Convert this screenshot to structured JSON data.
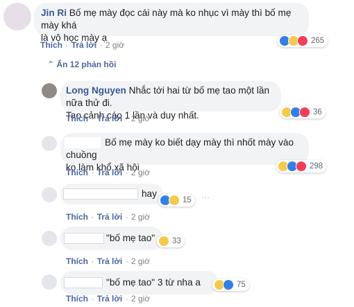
{
  "comments": [
    {
      "name": "Jin Ri",
      "text_line1": "Bố mẹ mày đọc cái này mà ko nhục vì mày thì bố mẹ mày khá",
      "text_line2": "là vô học mày ạ",
      "like": "Thích",
      "reply": "Trả lời",
      "time": "2 giờ",
      "reaction_count": "265"
    }
  ],
  "hidden_replies": "Ẩn 12 phản hồi",
  "replies": [
    {
      "name": "Long Nguyen",
      "text_line1": "Nhắc tới hai từ bố mẹ tao một lần nữa thử đi.",
      "text_line2": "Tao cảnh cáo 1 lần và duy nhất.",
      "like": "Thích",
      "reply": "Trả lời",
      "time": "2 giờ",
      "reaction_count": "36"
    },
    {
      "text_line1": "Bố mẹ mày ko biết dạy mày thì nhốt mày vào chuồng",
      "text_line2": "ko làm khổ xã hội",
      "like": "Thích",
      "reply": "Trả lời",
      "time": "2 giờ",
      "reaction_count": "298"
    },
    {
      "text": "hay",
      "like": "Thích",
      "reply": "Trả lời",
      "time": "2 giờ",
      "reaction_count": "15"
    },
    {
      "text": "\"bố mẹ tao\"",
      "like": "Thích",
      "reply": "Trả lời",
      "time": "2 giờ",
      "reaction_count": "33"
    },
    {
      "text": "\"bố mẹ tao\" 3 từ nha a",
      "like": "Thích",
      "reply": "Trả lời",
      "time": "2 giờ",
      "reaction_count": "75"
    }
  ],
  "colors": {
    "link": "#385898",
    "like": "#2f80ed",
    "haha": "#f7c948",
    "love": "#f33e58"
  }
}
